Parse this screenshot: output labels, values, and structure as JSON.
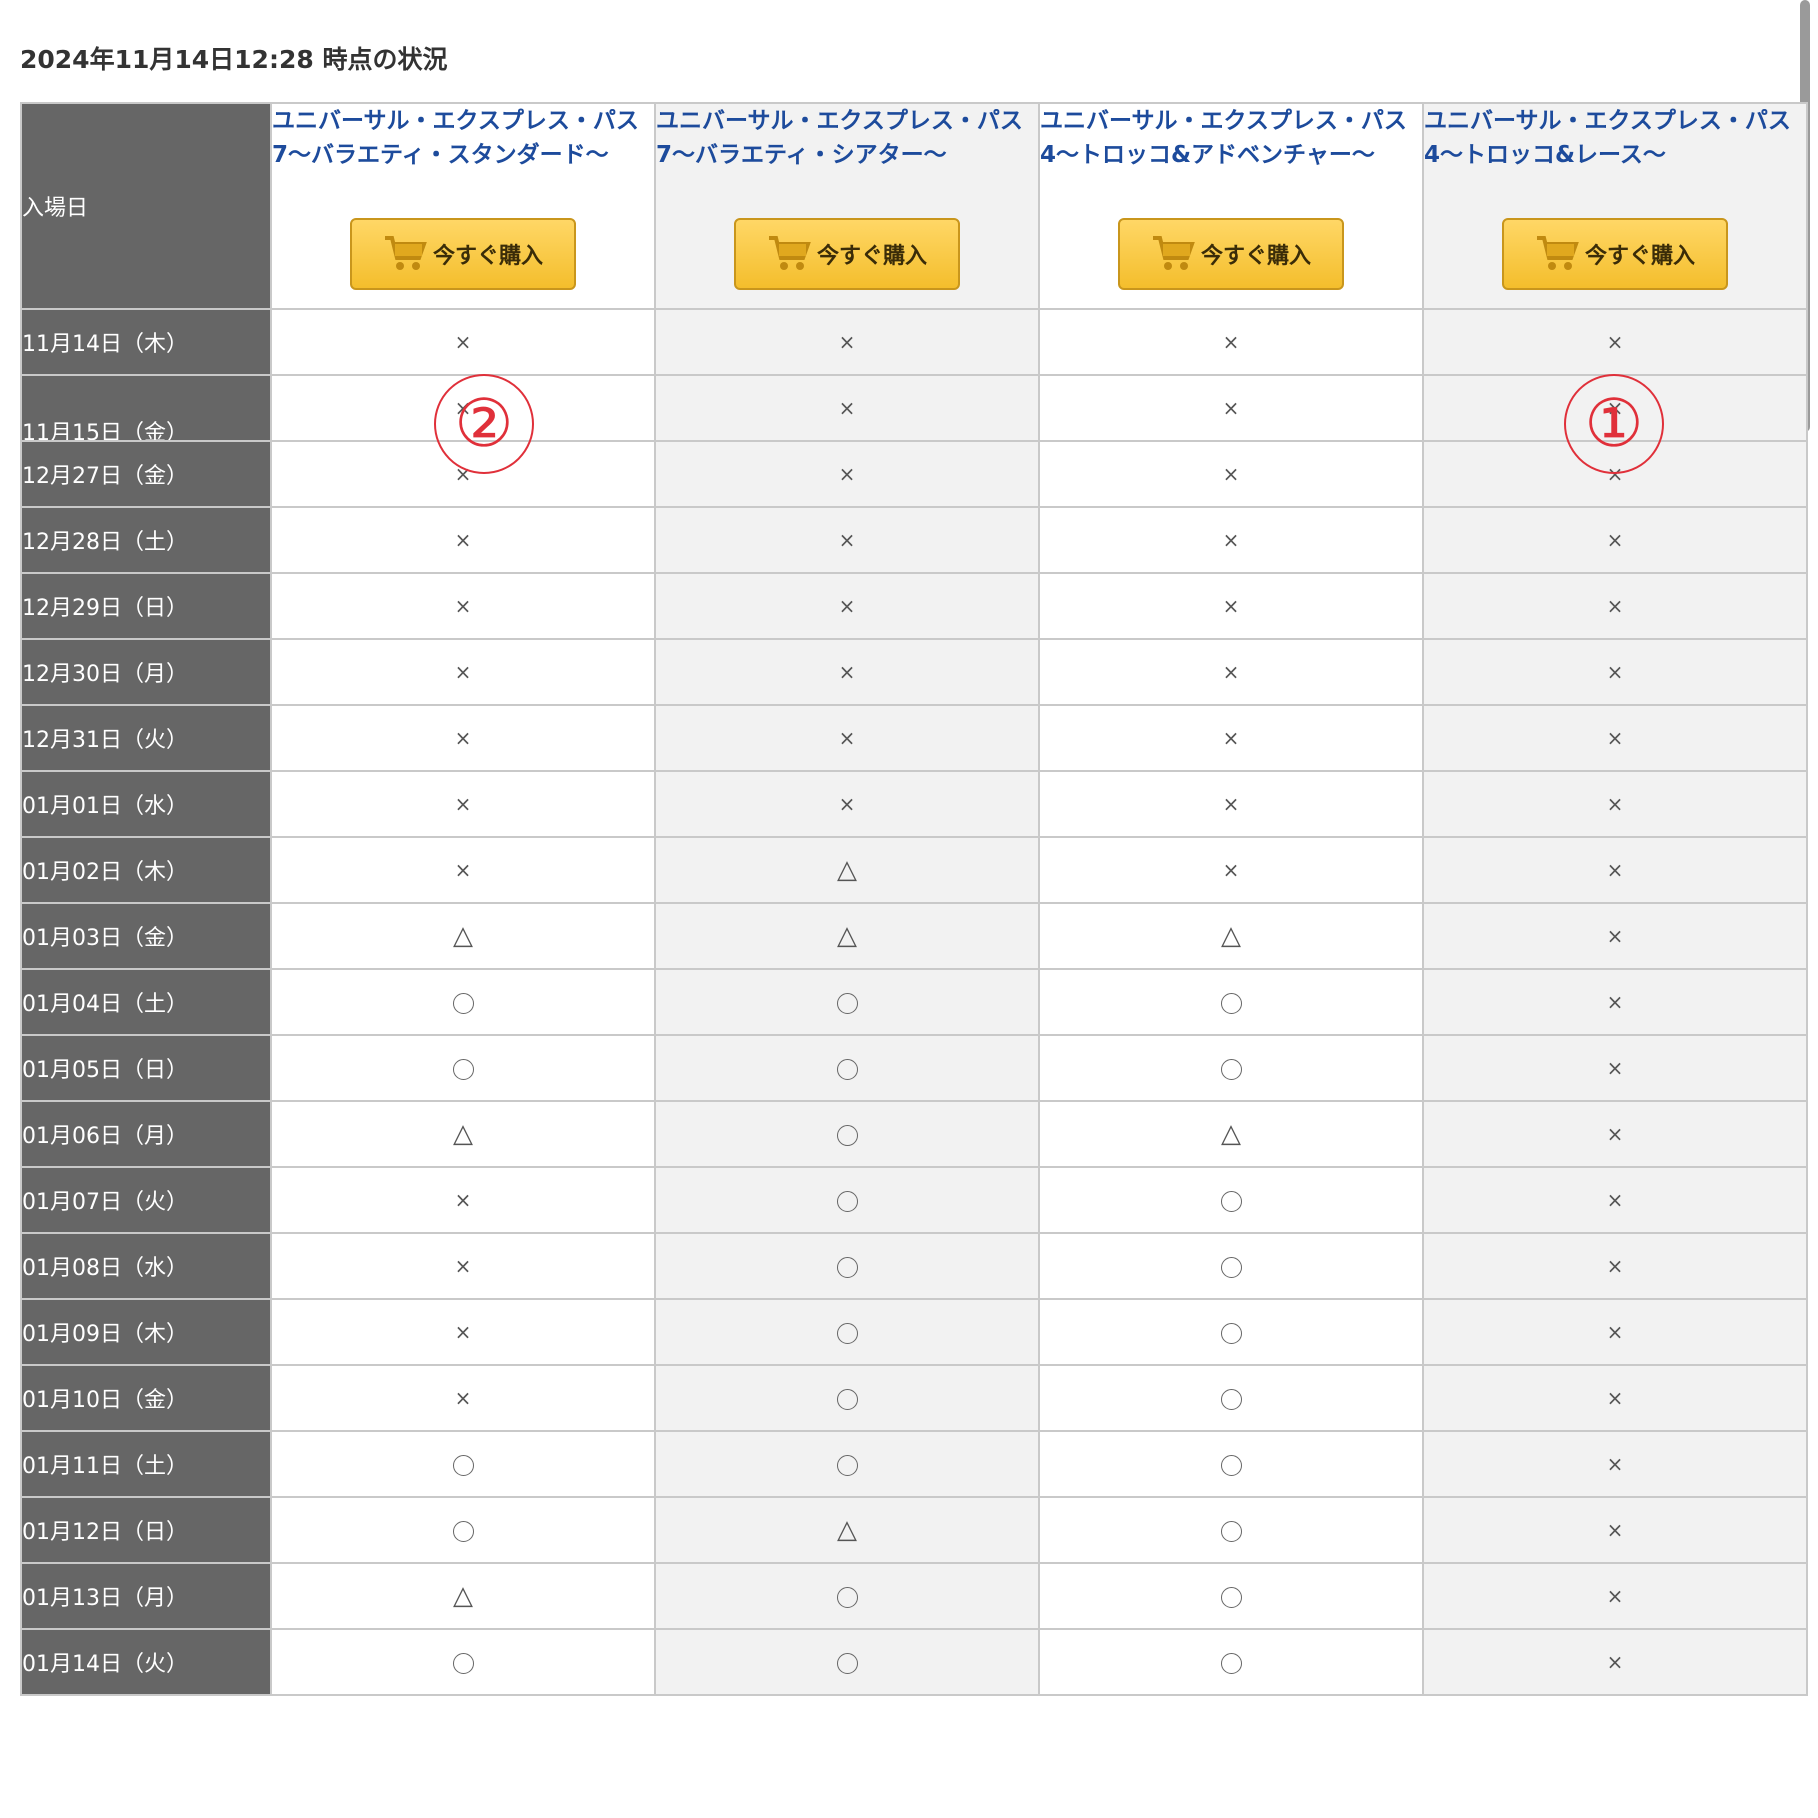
{
  "status_text": "2024年11月14日12:28 時点の状況",
  "table": {
    "date_header": "入場日",
    "products": [
      {
        "name": "ユニバーサル・エクスプレス・パス7〜バラエティ・スタンダード〜",
        "button": "今すぐ購入"
      },
      {
        "name": "ユニバーサル・エクスプレス・パス7〜バラエティ・シアター〜",
        "button": "今すぐ購入"
      },
      {
        "name": "ユニバーサル・エクスプレス・パス4〜トロッコ&アドベンチャー〜",
        "button": "今すぐ購入"
      },
      {
        "name": "ユニバーサル・エクスプレス・パス4〜トロッコ&レース〜",
        "button": "今すぐ購入"
      }
    ],
    "rows": [
      {
        "date": "11月14日（木）",
        "marks": [
          "×",
          "×",
          "×",
          "×"
        ]
      },
      {
        "date": "11月15日（金）",
        "marks": [
          "×",
          "×",
          "×",
          "×"
        ]
      },
      {
        "date": "12月27日（金）",
        "marks": [
          "×",
          "×",
          "×",
          "×"
        ]
      },
      {
        "date": "12月28日（土）",
        "marks": [
          "×",
          "×",
          "×",
          "×"
        ]
      },
      {
        "date": "12月29日（日）",
        "marks": [
          "×",
          "×",
          "×",
          "×"
        ]
      },
      {
        "date": "12月30日（月）",
        "marks": [
          "×",
          "×",
          "×",
          "×"
        ]
      },
      {
        "date": "12月31日（火）",
        "marks": [
          "×",
          "×",
          "×",
          "×"
        ]
      },
      {
        "date": "01月01日（水）",
        "marks": [
          "×",
          "×",
          "×",
          "×"
        ]
      },
      {
        "date": "01月02日（木）",
        "marks": [
          "×",
          "△",
          "×",
          "×"
        ]
      },
      {
        "date": "01月03日（金）",
        "marks": [
          "△",
          "△",
          "△",
          "×"
        ]
      },
      {
        "date": "01月04日（土）",
        "marks": [
          "○",
          "○",
          "○",
          "×"
        ]
      },
      {
        "date": "01月05日（日）",
        "marks": [
          "○",
          "○",
          "○",
          "×"
        ]
      },
      {
        "date": "01月06日（月）",
        "marks": [
          "△",
          "○",
          "△",
          "×"
        ]
      },
      {
        "date": "01月07日（火）",
        "marks": [
          "×",
          "○",
          "○",
          "×"
        ]
      },
      {
        "date": "01月08日（水）",
        "marks": [
          "×",
          "○",
          "○",
          "×"
        ]
      },
      {
        "date": "01月09日（木）",
        "marks": [
          "×",
          "○",
          "○",
          "×"
        ]
      },
      {
        "date": "01月10日（金）",
        "marks": [
          "×",
          "○",
          "○",
          "×"
        ]
      },
      {
        "date": "01月11日（土）",
        "marks": [
          "○",
          "○",
          "○",
          "×"
        ]
      },
      {
        "date": "01月12日（日）",
        "marks": [
          "○",
          "△",
          "○",
          "×"
        ]
      },
      {
        "date": "01月13日（月）",
        "marks": [
          "△",
          "○",
          "○",
          "×"
        ]
      },
      {
        "date": "01月14日（火）",
        "marks": [
          "○",
          "○",
          "○",
          "×"
        ]
      }
    ]
  },
  "annotations": {
    "one": "①",
    "two": "②"
  },
  "colors": {
    "date_column_bg": "#666666",
    "link": "#1d4b9c",
    "button_bg": "#f4be2c",
    "annotation": "#e0303a"
  }
}
